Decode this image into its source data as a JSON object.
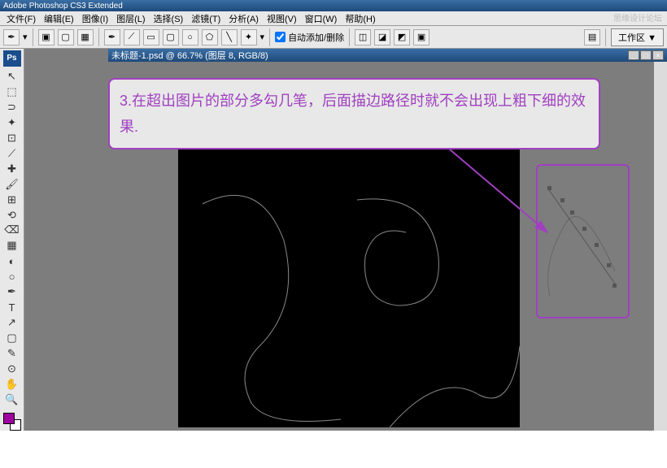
{
  "app": {
    "title": "Adobe Photoshop CS3 Extended"
  },
  "watermark": "思缘设计论坛",
  "menu": {
    "file": "文件(F)",
    "edit": "编辑(E)",
    "image": "图像(I)",
    "layer": "图层(L)",
    "select": "选择(S)",
    "filter": "滤镜(T)",
    "analysis": "分析(A)",
    "view": "视图(V)",
    "window": "窗口(W)",
    "help": "帮助(H)"
  },
  "options": {
    "auto_add_delete": "自动添加/删除",
    "workspace": "工作区 ▼"
  },
  "document": {
    "title": "未标题-1.psd @ 66.7% (图层 8, RGB/8)"
  },
  "annotation": {
    "text": "3.在超出图片的部分多勾几笔，后面描边路径时就不会出现上粗下细的效果."
  },
  "tools": {
    "ps": "Ps",
    "move": "↖",
    "marquee": "⬚",
    "lasso": "⊃",
    "wand": "✦",
    "crop": "⊡",
    "slice": "⟋",
    "healing": "✚",
    "brush": "🖌",
    "stamp": "⊞",
    "history": "⟲",
    "eraser": "⌫",
    "gradient": "▦",
    "blur": "◐",
    "dodge": "○",
    "pen": "✒",
    "type": "T",
    "path": "↗",
    "shape": "▢",
    "notes": "✎",
    "eyedrop": "⊙",
    "hand": "✋",
    "zoom": "🔍"
  },
  "colors": {
    "foreground": "#a000a0",
    "background": "#ffffff"
  }
}
